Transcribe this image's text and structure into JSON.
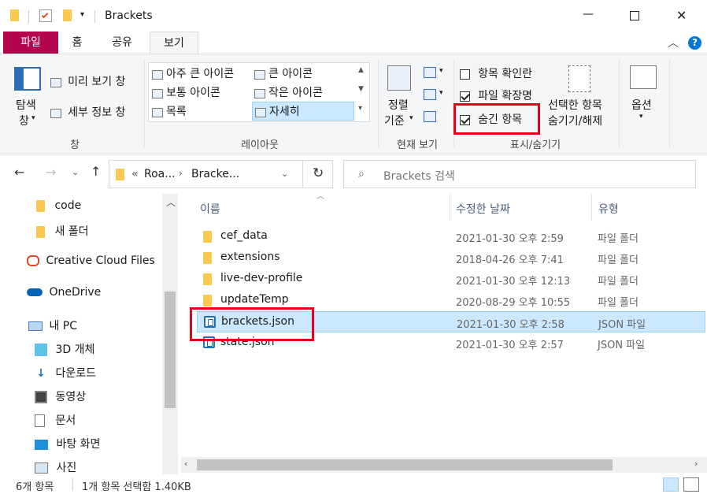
{
  "window": {
    "title": "Brackets",
    "minimize": "—",
    "maximize": "☐",
    "close": "✕"
  },
  "tabs": [
    {
      "label": "파일"
    },
    {
      "label": "홈"
    },
    {
      "label": "공유"
    },
    {
      "label": "보기"
    }
  ],
  "ribbon": {
    "nav_pane": {
      "label_line1": "탐색",
      "label_line2": "창"
    },
    "preview_pane": "미리 보기 창",
    "details_pane": "세부 정보 창",
    "group_pane": "창",
    "layout_items": [
      "아주 큰 아이콘",
      "큰 아이콘",
      "보통 아이콘",
      "작은 아이콘",
      "목록",
      "자세히"
    ],
    "group_layout": "레이아웃",
    "sort_line1": "정렬",
    "sort_line2": "기준",
    "group_current_view": "현재 보기",
    "item_checkboxes": "항목 확인란",
    "file_extensions": "파일 확장명",
    "hidden_items": "숨긴 항목",
    "hide_selected_line1": "선택한 항목",
    "hide_selected_line2": "숨기기/해제",
    "group_show_hide": "표시/숨기기",
    "options": "옵션"
  },
  "address": {
    "crumb1": "Roa...",
    "crumb2": "Bracke...",
    "prefix": "«",
    "search_placeholder": "Brackets 검색"
  },
  "nav_pane": [
    {
      "label": "code",
      "icon": "folder-icon"
    },
    {
      "label": "새 폴더",
      "icon": "folder-icon"
    },
    {
      "label": "Creative Cloud Files",
      "icon": "creative-cloud-icon"
    },
    {
      "label": "OneDrive",
      "icon": "onedrive-icon"
    },
    {
      "label": "내 PC",
      "icon": "pc-icon"
    },
    {
      "label": "3D 개체",
      "icon": "3d-objects-icon"
    },
    {
      "label": "다운로드",
      "icon": "download-icon"
    },
    {
      "label": "동영상",
      "icon": "video-icon"
    },
    {
      "label": "문서",
      "icon": "document-icon"
    },
    {
      "label": "바탕 화면",
      "icon": "desktop-icon"
    },
    {
      "label": "사진",
      "icon": "pictures-icon"
    }
  ],
  "columns": {
    "name": "이름",
    "date": "수정한 날짜",
    "type": "유형"
  },
  "files": [
    {
      "name": "cef_data",
      "date": "2021-01-30 오후 2:59",
      "type": "파일 폴더",
      "icon": "folder-icon"
    },
    {
      "name": "extensions",
      "date": "2018-04-26 오후 7:41",
      "type": "파일 폴더",
      "icon": "folder-icon"
    },
    {
      "name": "live-dev-profile",
      "date": "2021-01-30 오후 12:13",
      "type": "파일 폴더",
      "icon": "folder-icon"
    },
    {
      "name": "updateTemp",
      "date": "2020-08-29 오후 10:55",
      "type": "파일 폴더",
      "icon": "folder-icon"
    },
    {
      "name": "brackets.json",
      "date": "2021-01-30 오후 2:58",
      "type": "JSON 파일",
      "icon": "json-file-icon"
    },
    {
      "name": "state.json",
      "date": "2021-01-30 오후 2:57",
      "type": "JSON 파일",
      "icon": "json-file-icon"
    }
  ],
  "status": {
    "count": "6개 항목",
    "selection": "1개 항목 선택함 1.40KB"
  },
  "colors": {
    "file_tab": "#b4064e",
    "selection": "#cce8ff",
    "highlight_border": "#e3001b",
    "accent": "#0078d7"
  }
}
